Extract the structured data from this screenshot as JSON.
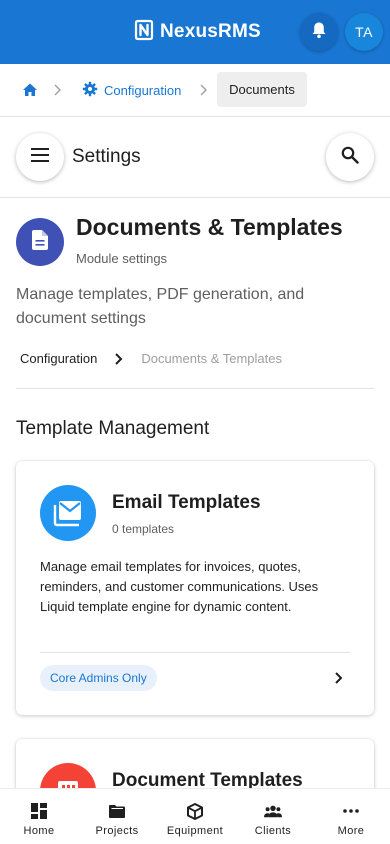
{
  "colors": {
    "app_bar": "#1976d2",
    "module_icon": "#3f51b5",
    "email_icon": "#2196f3",
    "document_icon": "#f44336",
    "chip_bg": "#e8f1fb"
  },
  "app": {
    "brand_name": "NexusRMS",
    "avatar_initials": "TA",
    "brand_icon": "nexus-logo-icon",
    "notifications_icon": "bell-icon"
  },
  "breadcrumb": {
    "home_icon": "home-icon",
    "items": [
      {
        "label": "Configuration",
        "icon": "gear-icon"
      },
      {
        "label": "Documents"
      }
    ]
  },
  "settings": {
    "title": "Settings",
    "menu_icon": "hamburger-menu-icon",
    "search_icon": "search-icon"
  },
  "module": {
    "icon": "document-icon",
    "title": "Documents & Templates",
    "subtitle": "Module settings",
    "description": "Manage templates, PDF generation, and document settings",
    "path": [
      "Configuration",
      "Documents & Templates"
    ]
  },
  "section": {
    "title": "Template Management"
  },
  "cards": [
    {
      "icon": "email-icon",
      "title": "Email Templates",
      "count": "0 templates",
      "description": "Manage email templates for invoices, quotes, reminders, and customer communications. Uses Liquid template engine for dynamic content.",
      "chip": "Core Admins Only"
    },
    {
      "icon": "document-template-icon",
      "title": "Document Templates"
    }
  ],
  "bottom_nav": [
    {
      "label": "Home",
      "icon": "dashboard-icon"
    },
    {
      "label": "Projects",
      "icon": "folder-icon"
    },
    {
      "label": "Equipment",
      "icon": "box-icon"
    },
    {
      "label": "Clients",
      "icon": "people-icon"
    },
    {
      "label": "More",
      "icon": "more-dots-icon"
    }
  ]
}
